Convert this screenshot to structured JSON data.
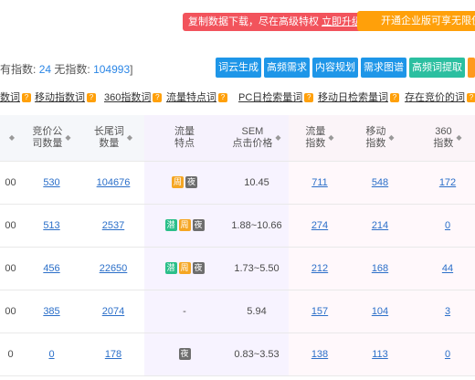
{
  "top_bar": {
    "notice_text": "复制数据下载，尽在高级特权",
    "notice_link": "立即升级",
    "enterprise_label": "开通企业版可享无限使用"
  },
  "stats": {
    "prefix": "有指数:",
    "indexed_count": "24",
    "no_index_label": "无指数:",
    "no_index_count": "104993",
    "suffix": "]"
  },
  "tools": [
    {
      "label": "词云生成",
      "color": "#1e96e8"
    },
    {
      "label": "高频需求",
      "color": "#1e96e8"
    },
    {
      "label": "内容规划",
      "color": "#1e96e8"
    },
    {
      "label": "需求图谱",
      "color": "#1e96e8"
    },
    {
      "label": "高频词提取",
      "color": "#2bbfa0"
    },
    {
      "label": "",
      "color": "#ff9a1e"
    }
  ],
  "filters": [
    "数词",
    "移动指数词",
    "360指数词",
    "流量特点词",
    "PC日检索量词",
    "移动日检索量词",
    "存在竞价的词"
  ],
  "table": {
    "headers": {
      "col0": "",
      "bid_companies": [
        "竞价公",
        "司数量"
      ],
      "longtail": [
        "长尾词",
        "数量"
      ],
      "feature": [
        "流量",
        "特点"
      ],
      "sem": [
        "SEM",
        "点击价格"
      ],
      "traffic": [
        "流量",
        "指数"
      ],
      "mobile": [
        "移动",
        "指数"
      ],
      "idx360": [
        "360",
        "指数"
      ]
    },
    "rows": [
      {
        "col0": "00",
        "bid": "530",
        "longtail": "104676",
        "badges": [
          "周",
          "夜"
        ],
        "sem": "10.45",
        "traffic": "711",
        "mobile": "548",
        "idx360": "172"
      },
      {
        "col0": "00",
        "bid": "513",
        "longtail": "2537",
        "badges": [
          "潜",
          "周",
          "夜"
        ],
        "sem": "1.88~10.66",
        "traffic": "274",
        "mobile": "214",
        "idx360": "0"
      },
      {
        "col0": "00",
        "bid": "456",
        "longtail": "22650",
        "badges": [
          "潜",
          "周",
          "夜"
        ],
        "sem": "1.73~5.50",
        "traffic": "212",
        "mobile": "168",
        "idx360": "44"
      },
      {
        "col0": "00",
        "bid": "385",
        "longtail": "2074",
        "badges": [],
        "feature_text": "-",
        "sem": "5.94",
        "traffic": "157",
        "mobile": "104",
        "idx360": "3"
      },
      {
        "col0": "0",
        "bid": "0",
        "longtail": "178",
        "badges": [
          "夜"
        ],
        "sem": "0.83~3.53",
        "traffic": "138",
        "mobile": "113",
        "idx360": "0"
      }
    ]
  },
  "colors": {
    "notice_bg": "#f2535c",
    "enterprise_bg": "#ffa00a",
    "link": "#2b6fc9",
    "badge_qian": "#2bbf8a",
    "badge_zhou": "#f5a623",
    "badge_ye": "#6e6e6e"
  }
}
